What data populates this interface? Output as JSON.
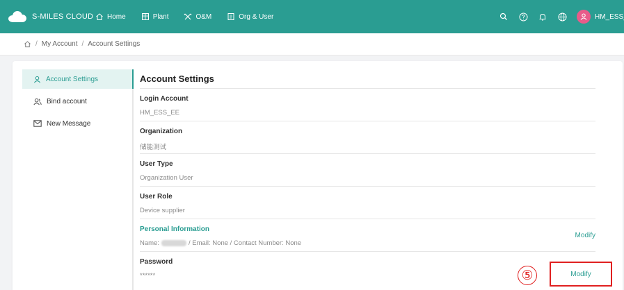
{
  "header": {
    "brand": "S-MILES CLOUD",
    "nav": [
      {
        "label": "Home",
        "icon": "home-icon"
      },
      {
        "label": "Plant",
        "icon": "grid-icon"
      },
      {
        "label": "O&M",
        "icon": "tools-icon"
      },
      {
        "label": "Org & User",
        "icon": "document-icon"
      }
    ],
    "tools": [
      "search-icon",
      "help-icon",
      "bell-icon",
      "globe-icon"
    ],
    "username": "HM_ESS_EE"
  },
  "breadcrumb": {
    "items": [
      "My Account",
      "Account Settings"
    ]
  },
  "sidebar": {
    "items": [
      {
        "label": "Account Settings",
        "icon": "user-icon",
        "active": true
      },
      {
        "label": "Bind account",
        "icon": "users-icon",
        "active": false
      },
      {
        "label": "New Message",
        "icon": "mail-icon",
        "active": false
      }
    ]
  },
  "main": {
    "title": "Account Settings",
    "login_account": {
      "label": "Login Account",
      "value": "HM_ESS_EE"
    },
    "organization": {
      "label": "Organization",
      "value": "储能测试"
    },
    "user_type": {
      "label": "User Type",
      "value": "Organization User"
    },
    "user_role": {
      "label": "User Role",
      "value": "Device supplier"
    },
    "personal_info": {
      "label": "Personal Information",
      "name_prefix": "Name:",
      "rest": "/ Email: None / Contact Number: None",
      "modify": "Modify"
    },
    "password": {
      "label": "Password",
      "value": "******",
      "modify": "Modify"
    }
  },
  "annotation": {
    "step": "⑤"
  },
  "colors": {
    "brand": "#2a9d92",
    "highlight": "#e02020"
  }
}
